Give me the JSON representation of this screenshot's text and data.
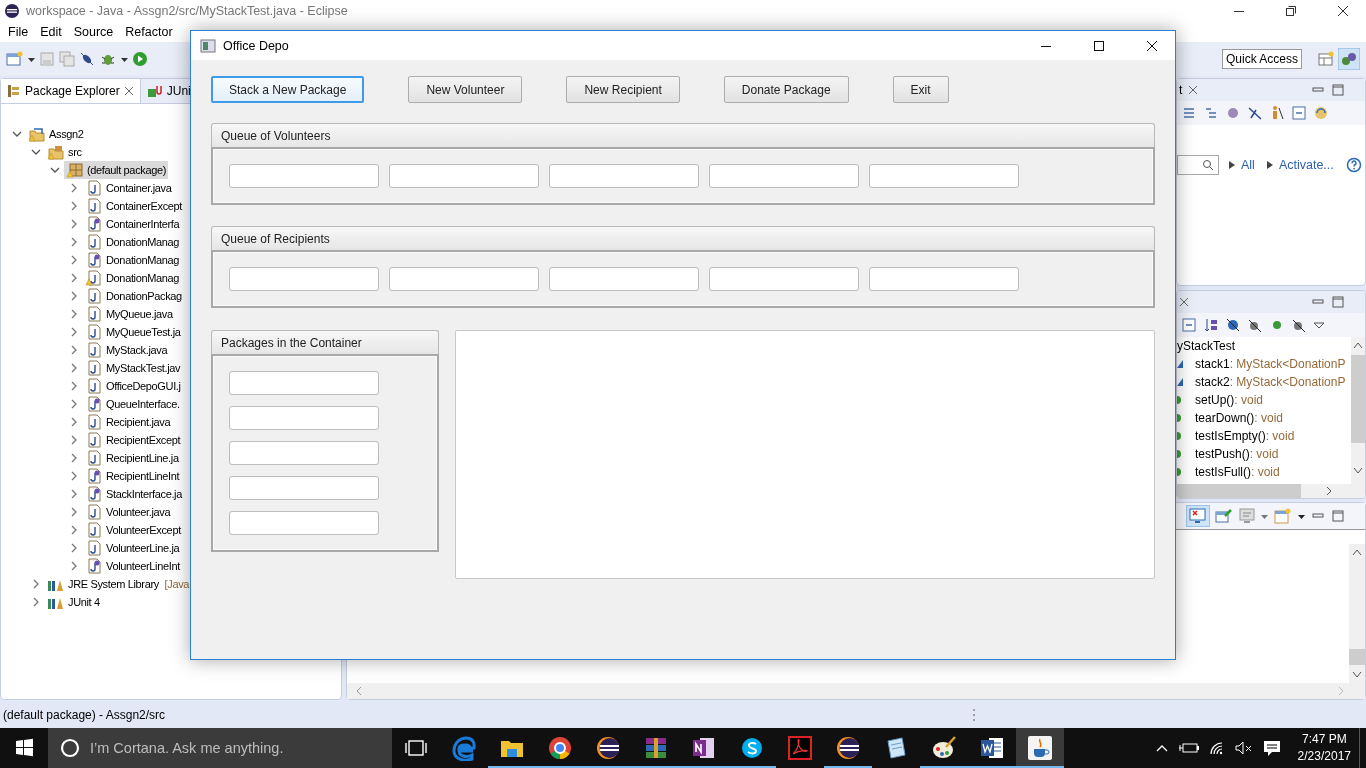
{
  "eclipse": {
    "title": "workspace - Java - Assgn2/src/MyStackTest.java - Eclipse",
    "menu": [
      "File",
      "Edit",
      "Source",
      "Refactor"
    ],
    "quick_access": "Quick Access",
    "explorer": {
      "tabs": [
        {
          "label": "Package Explorer",
          "selected": true
        },
        {
          "label": "JUni",
          "selected": false
        }
      ],
      "tree": [
        {
          "label": "Assgn2",
          "kind": "project",
          "warning": true,
          "expanded": true,
          "selected": false,
          "children": [
            {
              "label": "src",
              "kind": "source-folder",
              "warning": true,
              "expanded": true,
              "selected": false,
              "children": [
                {
                  "label": "(default package)",
                  "kind": "package",
                  "warning": true,
                  "expanded": true,
                  "selected": true,
                  "children": [
                    {
                      "label": "Container.java",
                      "kind": "class",
                      "warning": false,
                      "expanded": false,
                      "selected": false
                    },
                    {
                      "label": "ContainerExcept",
                      "kind": "class",
                      "warning": false,
                      "expanded": false,
                      "selected": false
                    },
                    {
                      "label": "ContainerInterfa",
                      "kind": "interface",
                      "warning": false,
                      "expanded": false,
                      "selected": false
                    },
                    {
                      "label": "DonationManag",
                      "kind": "class",
                      "warning": false,
                      "expanded": false,
                      "selected": false
                    },
                    {
                      "label": "DonationManag",
                      "kind": "interface",
                      "warning": false,
                      "expanded": false,
                      "selected": false
                    },
                    {
                      "label": "DonationManag",
                      "kind": "class",
                      "warning": true,
                      "expanded": false,
                      "selected": false
                    },
                    {
                      "label": "DonationPackag",
                      "kind": "class",
                      "warning": false,
                      "expanded": false,
                      "selected": false
                    },
                    {
                      "label": "MyQueue.java",
                      "kind": "class",
                      "warning": false,
                      "expanded": false,
                      "selected": false
                    },
                    {
                      "label": "MyQueueTest.ja",
                      "kind": "class",
                      "warning": false,
                      "expanded": false,
                      "selected": false
                    },
                    {
                      "label": "MyStack.java",
                      "kind": "class",
                      "warning": false,
                      "expanded": false,
                      "selected": false
                    },
                    {
                      "label": "MyStackTest.jav",
                      "kind": "class",
                      "warning": false,
                      "expanded": false,
                      "selected": false
                    },
                    {
                      "label": "OfficeDepoGUI.j",
                      "kind": "class",
                      "warning": false,
                      "expanded": false,
                      "selected": false
                    },
                    {
                      "label": "QueueInterface.",
                      "kind": "interface",
                      "warning": false,
                      "expanded": false,
                      "selected": false
                    },
                    {
                      "label": "Recipient.java",
                      "kind": "class",
                      "warning": false,
                      "expanded": false,
                      "selected": false
                    },
                    {
                      "label": "RecipientExcept",
                      "kind": "class",
                      "warning": false,
                      "expanded": false,
                      "selected": false
                    },
                    {
                      "label": "RecipientLine.ja",
                      "kind": "class",
                      "warning": false,
                      "expanded": false,
                      "selected": false
                    },
                    {
                      "label": "RecipientLineInt",
                      "kind": "interface",
                      "warning": false,
                      "expanded": false,
                      "selected": false
                    },
                    {
                      "label": "StackInterface.ja",
                      "kind": "interface",
                      "warning": false,
                      "expanded": false,
                      "selected": false
                    },
                    {
                      "label": "Volunteer.java",
                      "kind": "class",
                      "warning": false,
                      "expanded": false,
                      "selected": false
                    },
                    {
                      "label": "VolunteerExcept",
                      "kind": "class",
                      "warning": false,
                      "expanded": false,
                      "selected": false
                    },
                    {
                      "label": "VolunteerLine.ja",
                      "kind": "class",
                      "warning": false,
                      "expanded": false,
                      "selected": false
                    },
                    {
                      "label": "VolunteerLineInt",
                      "kind": "interface",
                      "warning": false,
                      "expanded": false,
                      "selected": false
                    }
                  ]
                }
              ]
            },
            {
              "label": "JRE System Library",
              "decoration": "[Java",
              "kind": "library",
              "warning": false,
              "expanded": false,
              "selected": false
            },
            {
              "label": "JUnit 4",
              "kind": "library",
              "warning": false,
              "expanded": false,
              "selected": false
            }
          ]
        }
      ]
    },
    "task_panel": {
      "tab": "t",
      "links": [
        "All",
        "Activate..."
      ]
    },
    "outline": {
      "root": "yStackTest",
      "members": [
        {
          "name": "stack1",
          "type": " : MyStack<DonationP",
          "kind": "field"
        },
        {
          "name": "stack2",
          "type": " : MyStack<DonationP",
          "kind": "field"
        },
        {
          "name": "setUp()",
          "type": " : void",
          "kind": "method"
        },
        {
          "name": "tearDown()",
          "type": " : void",
          "kind": "method"
        },
        {
          "name": "testIsEmpty()",
          "type": " : void",
          "kind": "method"
        },
        {
          "name": "testPush()",
          "type": " : void",
          "kind": "method"
        },
        {
          "name": "testIsFull()",
          "type": " : void",
          "kind": "method"
        }
      ]
    },
    "status_bar": "(default package) - Assgn2/src"
  },
  "dialog": {
    "title": "Office Depo",
    "buttons": [
      {
        "label": "Stack a New Package",
        "focused": true
      },
      {
        "label": "New Volunteer",
        "focused": false
      },
      {
        "label": "New Recipient",
        "focused": false
      },
      {
        "label": "Donate Package",
        "focused": false
      },
      {
        "label": "Exit",
        "focused": false
      }
    ],
    "queues": [
      {
        "title": "Queue of Volunteers",
        "fields": [
          {
            "kind": "text"
          },
          {
            "kind": "text"
          },
          {
            "kind": "text"
          },
          {
            "kind": "text"
          },
          {
            "kind": "text"
          }
        ]
      },
      {
        "title": "Queue of Recipients",
        "fields": [
          {
            "kind": "text"
          },
          {
            "kind": "text"
          },
          {
            "kind": "text"
          },
          {
            "kind": "text"
          },
          {
            "kind": "text"
          }
        ]
      }
    ],
    "container": {
      "title": "Packages in the Container",
      "fields": [
        {
          "kind": "text"
        },
        {
          "kind": "text"
        },
        {
          "kind": "text"
        },
        {
          "kind": "text"
        },
        {
          "kind": "text"
        }
      ]
    },
    "output": {
      "kind": "text-area"
    }
  },
  "taskbar": {
    "search": "I’m Cortana. Ask me anything.",
    "apps": [
      {
        "kind": "edge",
        "running": false,
        "selected": false
      },
      {
        "kind": "explorer",
        "running": true,
        "selected": false
      },
      {
        "kind": "chrome",
        "running": true,
        "selected": false
      },
      {
        "kind": "eclipse",
        "running": true,
        "selected": false
      },
      {
        "kind": "winrar",
        "running": true,
        "selected": false
      },
      {
        "kind": "onenote",
        "running": true,
        "selected": false
      },
      {
        "kind": "skype",
        "running": true,
        "selected": false
      },
      {
        "kind": "acrobat",
        "running": false,
        "selected": false
      },
      {
        "kind": "eclipse",
        "running": true,
        "selected": false
      },
      {
        "kind": "notepad",
        "running": false,
        "selected": false
      },
      {
        "kind": "paint",
        "running": true,
        "selected": false
      },
      {
        "kind": "word",
        "running": true,
        "selected": false
      },
      {
        "kind": "java",
        "running": true,
        "selected": true
      }
    ],
    "time": "7:47 PM",
    "date": "2/23/2017"
  }
}
